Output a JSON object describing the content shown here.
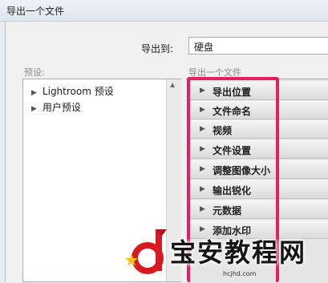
{
  "window": {
    "title": "导出一个文件"
  },
  "export_to": {
    "label": "导出到:",
    "value": "硬盘"
  },
  "presets": {
    "label": "预设:",
    "items": [
      {
        "label": "Lightroom 预设"
      },
      {
        "label": "用户预设"
      }
    ]
  },
  "file_panel": {
    "label": "导出一个文件",
    "sections": [
      {
        "label": "导出位置"
      },
      {
        "label": "文件命名"
      },
      {
        "label": "视频"
      },
      {
        "label": "文件设置"
      },
      {
        "label": "调整图像大小"
      },
      {
        "label": "输出锐化"
      },
      {
        "label": "元数据"
      },
      {
        "label": "添加水印"
      }
    ]
  },
  "highlight_color": "#e81e63",
  "watermark": {
    "text": "宝安教程网",
    "url": "hcjhd.com",
    "logo_icon": "d-logo-icon"
  }
}
